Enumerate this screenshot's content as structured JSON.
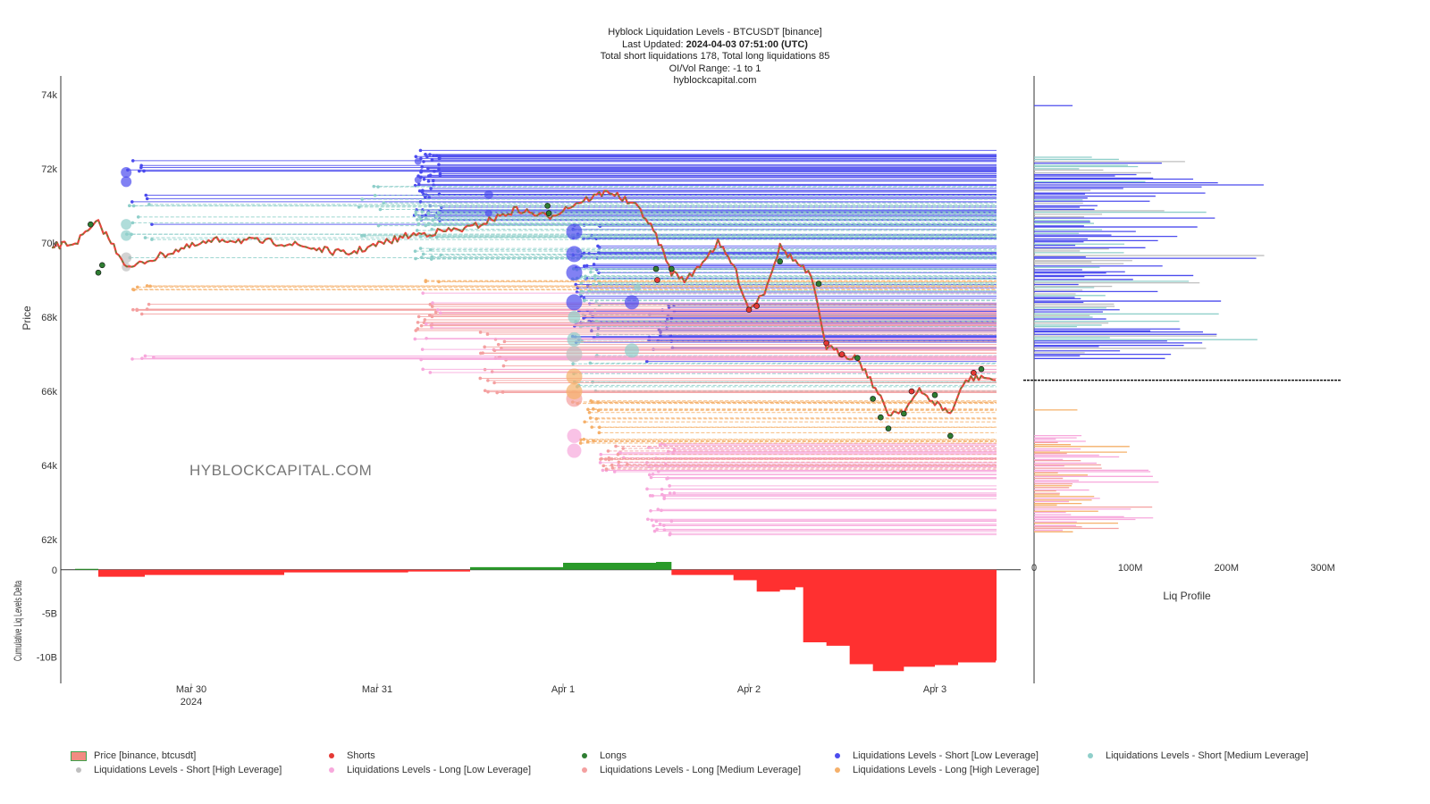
{
  "title": {
    "line1": "Hyblock Liquidation Levels - BTCUSDT [binance]",
    "updated_label": "Last Updated: ",
    "updated_value": "2024-04-03 07:51:00 (UTC)",
    "line3": "Total short liquidations 178, Total long liquidations 85",
    "line4": "OI/Vol Range: -1 to 1",
    "line5": "hyblockcapital.com"
  },
  "watermark": "HYBLOCKCAPITAL.COM",
  "colors": {
    "short_low": "#4b4bee",
    "short_medium": "#8fcfca",
    "short_high": "#bfbfbf",
    "long_low": "#f7a8dc",
    "long_medium": "#f4a0a0",
    "long_high": "#f5b06a",
    "price_up": "#2f9e3a",
    "price_down": "#e8453c",
    "delta_pos": "#2a9a2a",
    "delta_neg": "#ff3030"
  },
  "chart_data": [
    {
      "type": "line",
      "name": "price",
      "ylabel": "Price",
      "ylim": [
        61500,
        74500
      ],
      "yticks": [
        "74k",
        "72k",
        "70k",
        "68k",
        "66k",
        "64k",
        "62k"
      ],
      "ytick_values": [
        74000,
        72000,
        70000,
        68000,
        66000,
        64000,
        62000
      ],
      "xticks": [
        "Mar 30",
        "Mar 31",
        "Apr 1",
        "Apr 2",
        "Apr 3"
      ],
      "xtick_sub": [
        "2024",
        "",
        "",
        "",
        ""
      ],
      "xlim_days": [
        "2024-03-29 06:00",
        "2024-04-03 11:00"
      ],
      "price_series": {
        "x": [
          "03-29 06:00",
          "03-29 09:00",
          "03-29 12:00",
          "03-29 14:00",
          "03-29 16:00",
          "03-29 18:00",
          "03-29 22:00",
          "03-30 04:00",
          "03-30 12:00",
          "03-30 20:00",
          "03-31 04:00",
          "03-31 12:00",
          "03-31 18:00",
          "03-31 22:00",
          "04-01 02:00",
          "04-01 06:00",
          "04-01 10:00",
          "04-01 12:00",
          "04-01 14:00",
          "04-01 16:00",
          "04-01 20:00",
          "04-01 22:00",
          "04-02 00:00",
          "04-02 02:00",
          "04-02 04:00",
          "04-02 06:00",
          "04-02 08:00",
          "04-02 10:00",
          "04-02 12:00",
          "04-02 14:00",
          "04-02 16:00",
          "04-02 18:00",
          "04-02 20:00",
          "04-02 22:00",
          "04-03 00:00",
          "04-03 02:00",
          "04-03 04:00",
          "04-03 06:00",
          "04-03 07:51"
        ],
        "y": [
          69900,
          70000,
          70550,
          69900,
          69300,
          69500,
          69800,
          70100,
          70000,
          69700,
          70200,
          70400,
          70900,
          70700,
          71100,
          71400,
          70900,
          70200,
          69200,
          69000,
          70000,
          69400,
          68200,
          68700,
          69900,
          69500,
          69100,
          67200,
          67000,
          66900,
          66200,
          65400,
          65500,
          66000,
          65700,
          65400,
          66300,
          66400,
          66300
        ]
      },
      "shorts_count": 178,
      "longs_count": 85
    },
    {
      "type": "area",
      "name": "cumulative-liq-levels-delta",
      "ylabel": "Cumulative Liq Levels Delta",
      "ylim": [
        -13000000000,
        1000000000
      ],
      "yticks": [
        "0",
        "-5B",
        "-10B"
      ],
      "ytick_values": [
        0,
        -5000000000,
        -10000000000
      ],
      "x": [
        "03-29 06:00",
        "03-29 09:00",
        "03-29 12:00",
        "03-29 18:00",
        "03-30 12:00",
        "03-31 04:00",
        "03-31 12:00",
        "04-01 00:00",
        "04-01 12:00",
        "04-01 14:00",
        "04-01 22:00",
        "04-02 01:00",
        "04-02 04:00",
        "04-02 06:00",
        "04-02 07:00",
        "04-02 10:00",
        "04-02 13:00",
        "04-02 16:00",
        "04-02 20:00",
        "04-03 00:00",
        "04-03 03:00",
        "04-03 07:51"
      ],
      "y": [
        0,
        100000000.0,
        -800000000.0,
        -600000000.0,
        -300000000.0,
        -200000000.0,
        300000000.0,
        800000000.0,
        900000000.0,
        -600000000.0,
        -1200000000.0,
        -2500000000.0,
        -2300000000.0,
        -2000000000.0,
        -8300000000.0,
        -8700000000.0,
        -10800000000.0,
        -11600000000.0,
        -11100000000.0,
        -10900000000.0,
        -10600000000.0,
        -10400000000.0
      ]
    },
    {
      "type": "bar",
      "name": "liq-profile",
      "xlabel": "Liq Profile",
      "xticks": [
        "0",
        "100M",
        "200M",
        "300M"
      ],
      "xtick_values": [
        0,
        100000000,
        200000000,
        300000000
      ],
      "current_price": 66300
    }
  ],
  "legend": [
    {
      "label": "Price [binance, btcusdt]",
      "kind": "price"
    },
    {
      "label": "Shorts",
      "kind": "dot",
      "color": "#e53935"
    },
    {
      "label": "Longs",
      "kind": "dot",
      "color": "#2e7d32"
    },
    {
      "label": "Liquidations Levels - Short [Low Leverage]",
      "kind": "dot",
      "color": "#4b4bee"
    },
    {
      "label": "Liquidations Levels - Short [Medium Leverage]",
      "kind": "dot",
      "color": "#8fcfca"
    },
    {
      "label": "Liquidations Levels - Short [High Leverage]",
      "kind": "dot",
      "color": "#bfbfbf"
    },
    {
      "label": "Liquidations Levels - Long [Low Leverage]",
      "kind": "dot",
      "color": "#f7a8dc"
    },
    {
      "label": "Liquidations Levels - Long [Medium Leverage]",
      "kind": "dot",
      "color": "#f4a0a0"
    },
    {
      "label": "Liquidations Levels - Long [High Leverage]",
      "kind": "dot",
      "color": "#f5b06a"
    }
  ]
}
